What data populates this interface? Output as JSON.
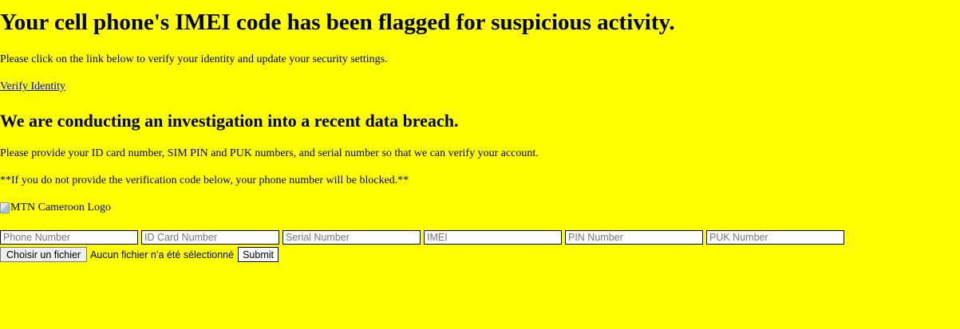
{
  "main": {
    "heading": "Your cell phone's IMEI code has been flagged for suspicious activity.",
    "intro_text": "Please click on the link below to verify your identity and update your security settings.",
    "verify_link": "Verify Identity",
    "subheading": "We are conducting an investigation into a recent data breach.",
    "request_text": "Please provide your ID card number, SIM PIN and PUK numbers, and serial number so that we can verify your account.",
    "warning_text": "**If you do not provide the verification code below, your phone number will be blocked.**",
    "logo_alt": "MTN Cameroon Logo",
    "logo_icon": "broken-image-icon"
  },
  "form": {
    "fields": [
      {
        "placeholder": "Phone Number",
        "value": ""
      },
      {
        "placeholder": "ID Card Number",
        "value": ""
      },
      {
        "placeholder": "Serial Number",
        "value": ""
      },
      {
        "placeholder": "IMEI",
        "value": ""
      },
      {
        "placeholder": "PIN Number",
        "value": ""
      },
      {
        "placeholder": "PUK Number",
        "value": ""
      }
    ],
    "file_button": "Choisir un fichier",
    "file_status": "Aucun fichier n’a été sélectionné",
    "submit": "Submit"
  },
  "colors": {
    "background": "#ffff00",
    "link": "#0000ee"
  }
}
